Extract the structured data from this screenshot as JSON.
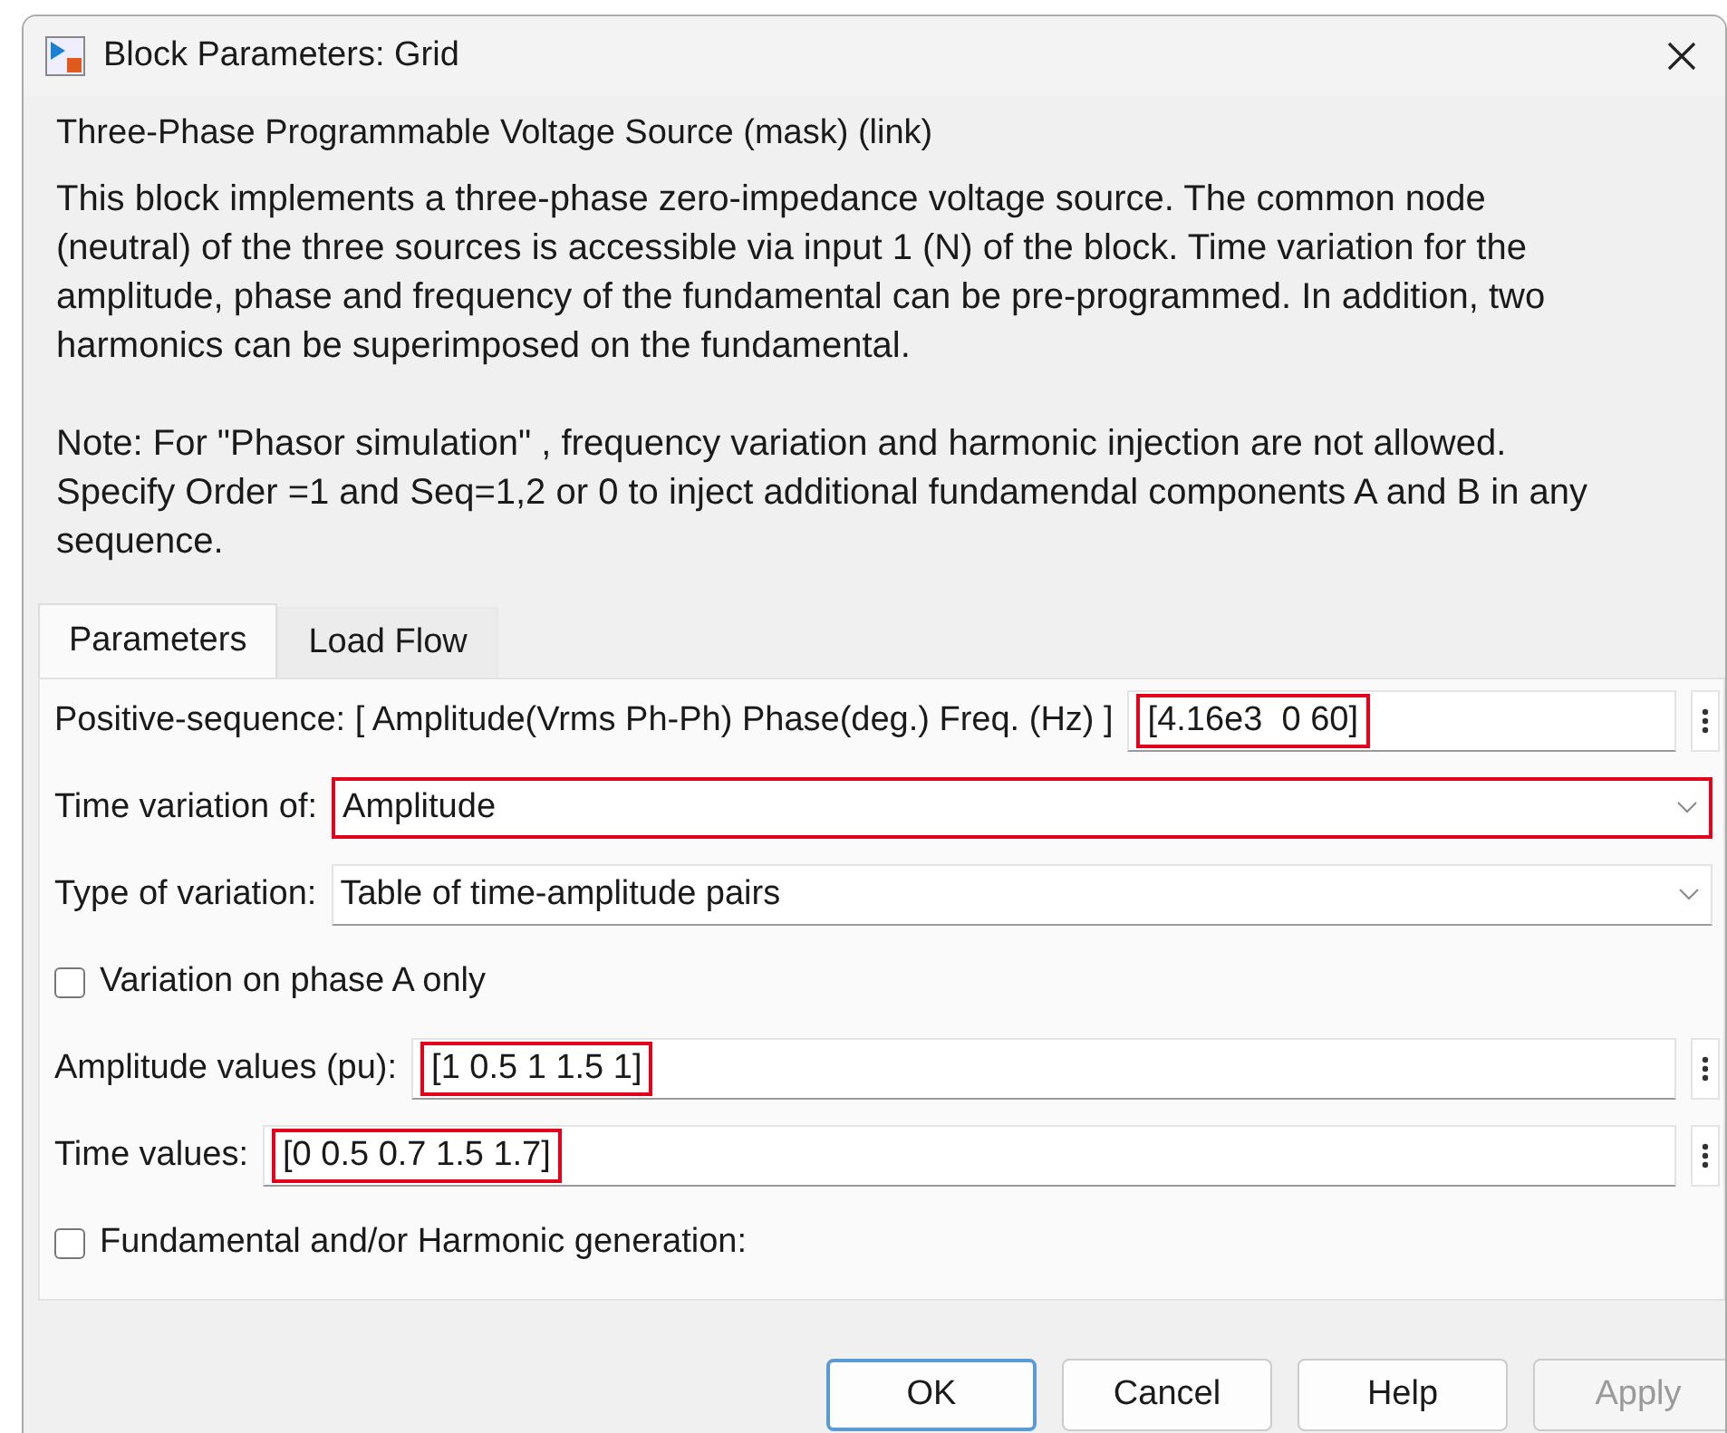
{
  "window": {
    "title": "Block Parameters: Grid"
  },
  "mask_title": "Three-Phase Programmable Voltage Source (mask) (link)",
  "description": [
    "This block implements a three-phase zero-impedance voltage source. The common node (neutral) of the three sources is accessible via input 1 (N) of the block. Time variation for the amplitude, phase and frequency of the fundamental can be pre-programmed. In addition, two harmonics can be superimposed on the fundamental.",
    "Note: For  \"Phasor simulation\" , frequency variation and harmonic injection are not allowed. Specify  Order =1 and Seq=1,2 or 0 to inject additional fundamendal components A and B in  any sequence."
  ],
  "tabs": [
    {
      "label": "Parameters",
      "selected": true
    },
    {
      "label": "Load Flow",
      "selected": false
    }
  ],
  "parameters": [
    {
      "kind": "text",
      "label": "Positive-sequence: [ Amplitude(Vrms Ph-Ph)  Phase(deg.)   Freq. (Hz) ]",
      "value": "[4.16e3  0 60]",
      "highlighted": true
    },
    {
      "kind": "dropdown",
      "label": "Time variation of:",
      "value": "Amplitude",
      "highlighted": true
    },
    {
      "kind": "dropdown",
      "label": "Type of variation:",
      "value": "Table of time-amplitude pairs",
      "highlighted": false
    },
    {
      "kind": "checkbox",
      "label": "Variation on phase A only",
      "checked": false
    },
    {
      "kind": "text",
      "label": "Amplitude values (pu):",
      "value": "[1 0.5 1 1.5 1]",
      "highlighted": true
    },
    {
      "kind": "text",
      "label": "Time values:",
      "value": "[0 0.5 0.7 1.5 1.7]",
      "highlighted": true
    },
    {
      "kind": "checkbox",
      "label": "Fundamental and/or Harmonic generation:",
      "checked": false
    }
  ],
  "buttons": [
    {
      "label": "OK",
      "disabled": false,
      "default": true
    },
    {
      "label": "Cancel",
      "disabled": false,
      "default": false
    },
    {
      "label": "Help",
      "disabled": false,
      "default": false
    },
    {
      "label": "Apply",
      "disabled": true,
      "default": false
    }
  ]
}
